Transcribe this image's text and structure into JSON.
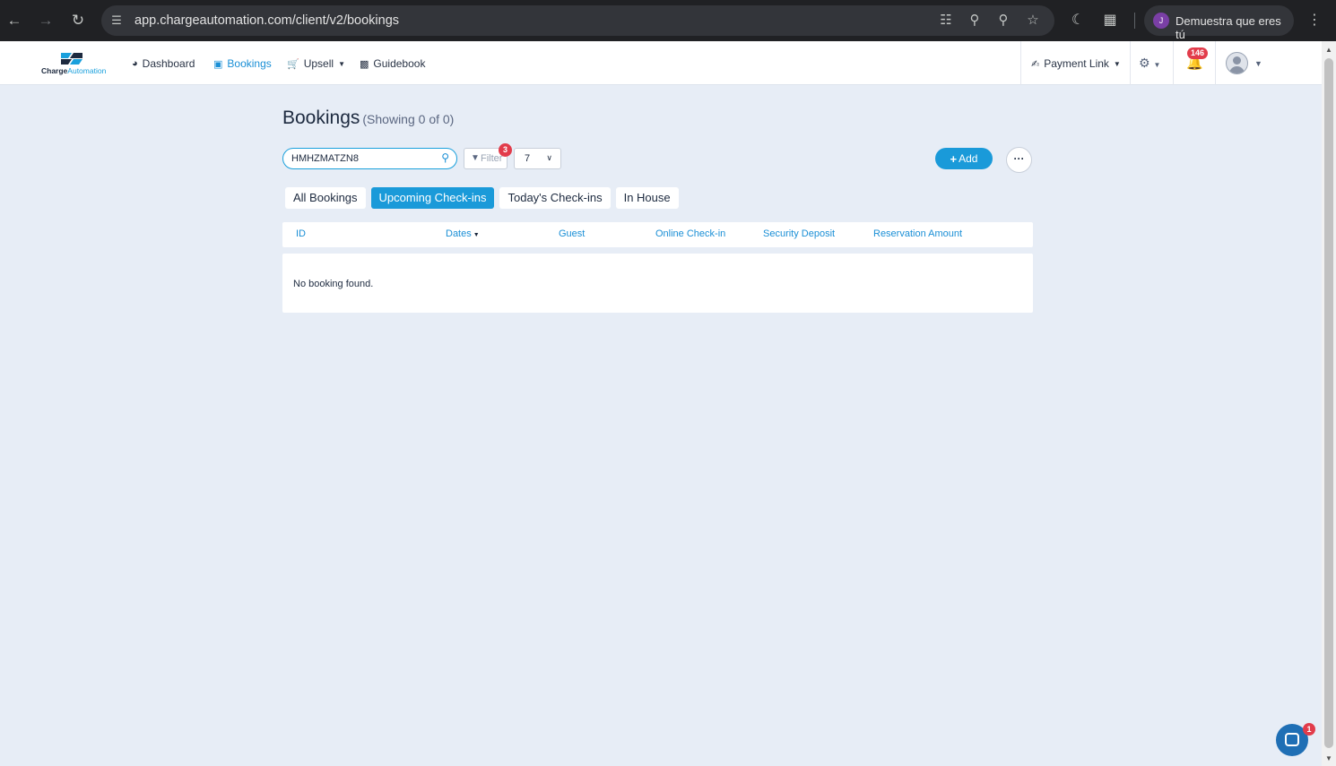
{
  "browser": {
    "url": "app.chargeautomation.com/client/v2/bookings",
    "profile_label": "Demuestra que eres tú",
    "profile_initial": "J"
  },
  "header": {
    "logo_brand_a": "Charge",
    "logo_brand_b": "Automation",
    "nav": [
      {
        "label": "Dashboard",
        "icon": "chart-pie-icon"
      },
      {
        "label": "Bookings",
        "icon": "calendar-icon"
      },
      {
        "label": "Upsell",
        "icon": "cart-icon"
      },
      {
        "label": "Guidebook",
        "icon": "book-icon"
      }
    ],
    "payment_link": "Payment Link",
    "notifications_count": "146"
  },
  "page": {
    "title": "Bookings",
    "subtitle": "(Showing 0 of 0)",
    "search_value": "HMHZMATZN8",
    "filter_label": "Filter",
    "filter_count": "3",
    "page_size": "7",
    "add_label": "Add",
    "more_label": "···",
    "tabs": [
      {
        "label": "All Bookings",
        "active": false
      },
      {
        "label": "Upcoming Check-ins",
        "active": true
      },
      {
        "label": "Today's Check-ins",
        "active": false
      },
      {
        "label": "In House",
        "active": false
      }
    ],
    "columns": [
      "ID",
      "Dates",
      "Guest",
      "Online Check-in",
      "Security Deposit",
      "Reservation Amount"
    ],
    "empty_message": "No booking found."
  },
  "chat": {
    "badge": "1"
  },
  "colors": {
    "accent": "#1a9ad9",
    "badge": "#e23c4b",
    "background": "#e7edf6"
  }
}
